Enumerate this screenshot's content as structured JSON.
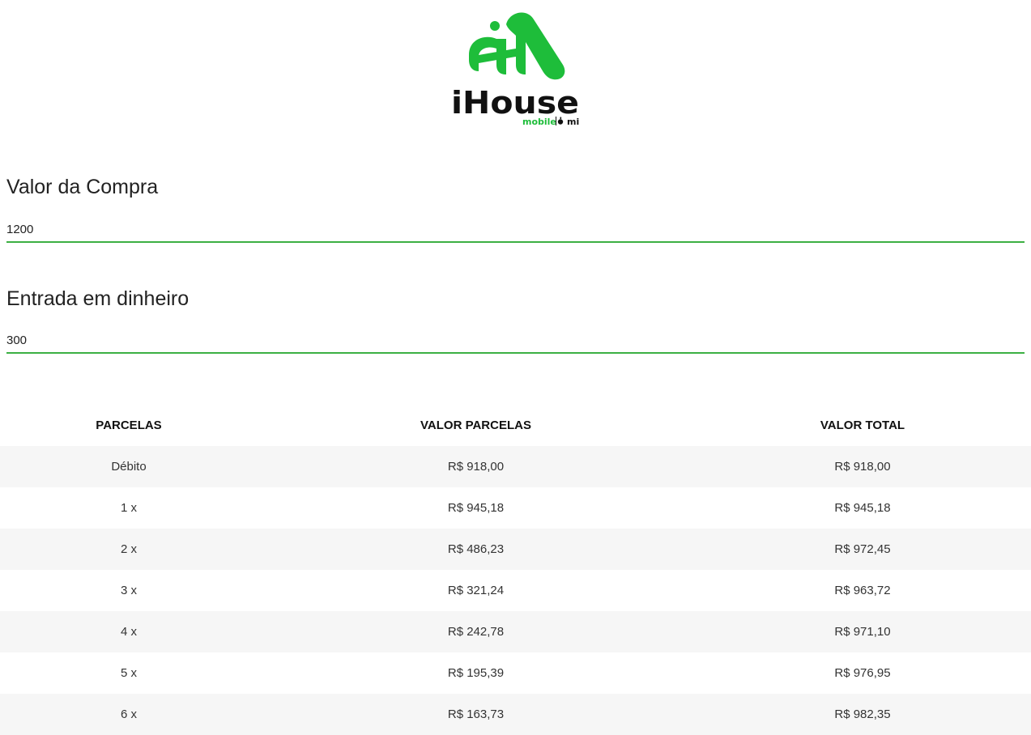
{
  "logo": {
    "brand": "iHouse",
    "tagline": "mobile",
    "sub_brands": "mi",
    "brand_color": "#1ebd3a"
  },
  "form": {
    "purchase_label": "Valor da Compra",
    "purchase_value": "1200",
    "down_payment_label": "Entrada em dinheiro",
    "down_payment_value": "300",
    "accent_color": "#3cb043"
  },
  "table": {
    "headers": [
      "PARCELAS",
      "VALOR PARCELAS",
      "VALOR TOTAL"
    ],
    "rows": [
      [
        "Débito",
        "R$ 918,00",
        "R$ 918,00"
      ],
      [
        "1 x",
        "R$ 945,18",
        "R$ 945,18"
      ],
      [
        "2 x",
        "R$ 486,23",
        "R$ 972,45"
      ],
      [
        "3 x",
        "R$ 321,24",
        "R$ 963,72"
      ],
      [
        "4 x",
        "R$ 242,78",
        "R$ 971,10"
      ],
      [
        "5 x",
        "R$ 195,39",
        "R$ 976,95"
      ],
      [
        "6 x",
        "R$ 163,73",
        "R$ 982,35"
      ]
    ]
  }
}
